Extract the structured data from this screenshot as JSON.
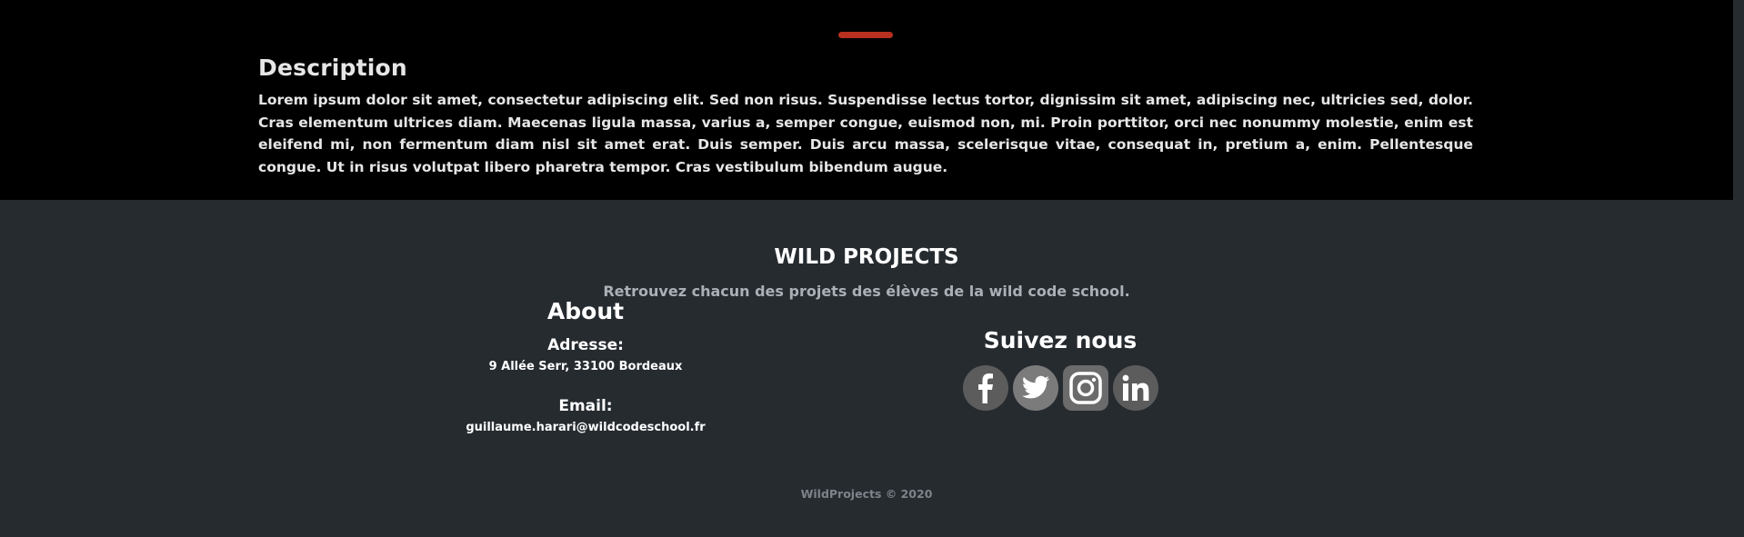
{
  "description": {
    "title": "Description",
    "text": "Lorem ipsum dolor sit amet, consectetur adipiscing elit. Sed non risus. Suspendisse lectus tortor, dignissim sit amet, adipiscing nec, ultricies sed, dolor. Cras elementum ultrices diam. Maecenas ligula massa, varius a, semper congue, euismod non, mi. Proin porttitor, orci nec nonummy molestie, enim est eleifend mi, non fermentum diam nisl sit amet erat. Duis semper. Duis arcu massa, scelerisque vitae, consequat in, pretium a, enim. Pellentesque congue. Ut in risus volutpat libero pharetra tempor. Cras vestibulum bibendum augue."
  },
  "footer": {
    "brand": "WILD PROJECTS",
    "tagline": "Retrouvez chacun des projets des élèves de la wild code school.",
    "about": {
      "title": "About",
      "address_label": "Adresse:",
      "address": "9 Allée Serr, 33100 Bordeaux",
      "email_label": "Email:",
      "email": "guillaume.harari@wildcodeschool.fr"
    },
    "social": {
      "title": "Suivez nous",
      "icons": [
        "facebook-icon",
        "twitter-icon",
        "instagram-icon",
        "linkedin-icon"
      ]
    },
    "copyright": "WildProjects © 2020"
  },
  "colors": {
    "accent": "#b8301f",
    "footer_bg": "#262b30"
  }
}
